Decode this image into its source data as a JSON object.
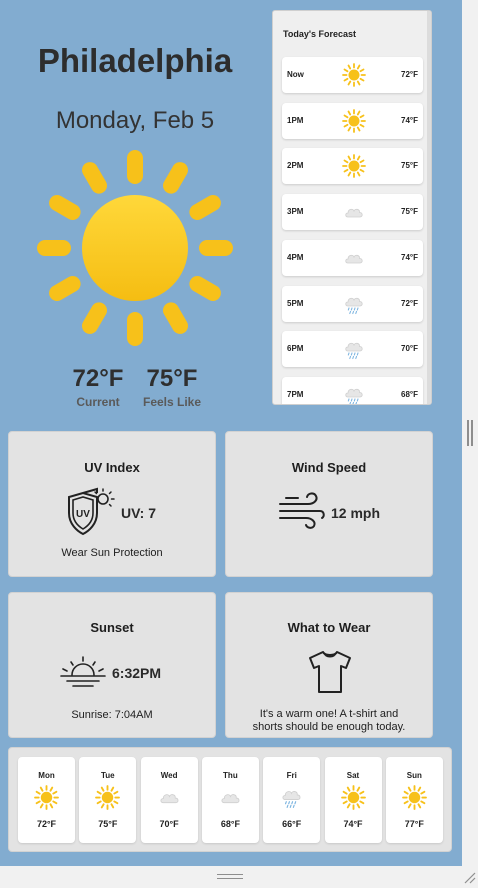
{
  "city": "Philadelphia",
  "date": "Monday, Feb 5",
  "current": {
    "temp": "72°F",
    "temp_label": "Current",
    "feels": "75°F",
    "feels_label": "Feels Like"
  },
  "forecast": {
    "title": "Today's Forecast",
    "rows": [
      {
        "time": "Now",
        "icon": "sun-icon",
        "temp": "72°F"
      },
      {
        "time": "1PM",
        "icon": "sun-icon",
        "temp": "74°F"
      },
      {
        "time": "2PM",
        "icon": "sun-icon",
        "temp": "75°F"
      },
      {
        "time": "3PM",
        "icon": "cloud-icon",
        "temp": "75°F"
      },
      {
        "time": "4PM",
        "icon": "cloud-icon",
        "temp": "74°F"
      },
      {
        "time": "5PM",
        "icon": "rain-icon",
        "temp": "72°F"
      },
      {
        "time": "6PM",
        "icon": "rain-icon",
        "temp": "70°F"
      },
      {
        "time": "7PM",
        "icon": "rain-icon",
        "temp": "68°F"
      }
    ]
  },
  "uv": {
    "title": "UV Index",
    "value": "UV: 7",
    "badge": "UV",
    "note": "Wear Sun Protection"
  },
  "wind": {
    "title": "Wind Speed",
    "value": "12 mph"
  },
  "sunset": {
    "title": "Sunset",
    "value": "6:32PM",
    "sunrise": "Sunrise: 7:04AM"
  },
  "wear": {
    "title": "What to Wear",
    "note_line1": "It's a warm one! A t-shirt and",
    "note_line2": "shorts should be enough today."
  },
  "weekly": [
    {
      "day": "Mon",
      "icon": "sun-icon",
      "temp": "72°F"
    },
    {
      "day": "Tue",
      "icon": "sun-icon",
      "temp": "75°F"
    },
    {
      "day": "Wed",
      "icon": "cloud-icon",
      "temp": "70°F"
    },
    {
      "day": "Thu",
      "icon": "cloud-icon",
      "temp": "68°F"
    },
    {
      "day": "Fri",
      "icon": "rain-icon",
      "temp": "66°F"
    },
    {
      "day": "Sat",
      "icon": "sun-icon",
      "temp": "74°F"
    },
    {
      "day": "Sun",
      "icon": "sun-icon",
      "temp": "77°F"
    }
  ],
  "colors": {
    "background": "#82acd0",
    "sun": "#f7c11a",
    "card": "#e3e3e3"
  }
}
